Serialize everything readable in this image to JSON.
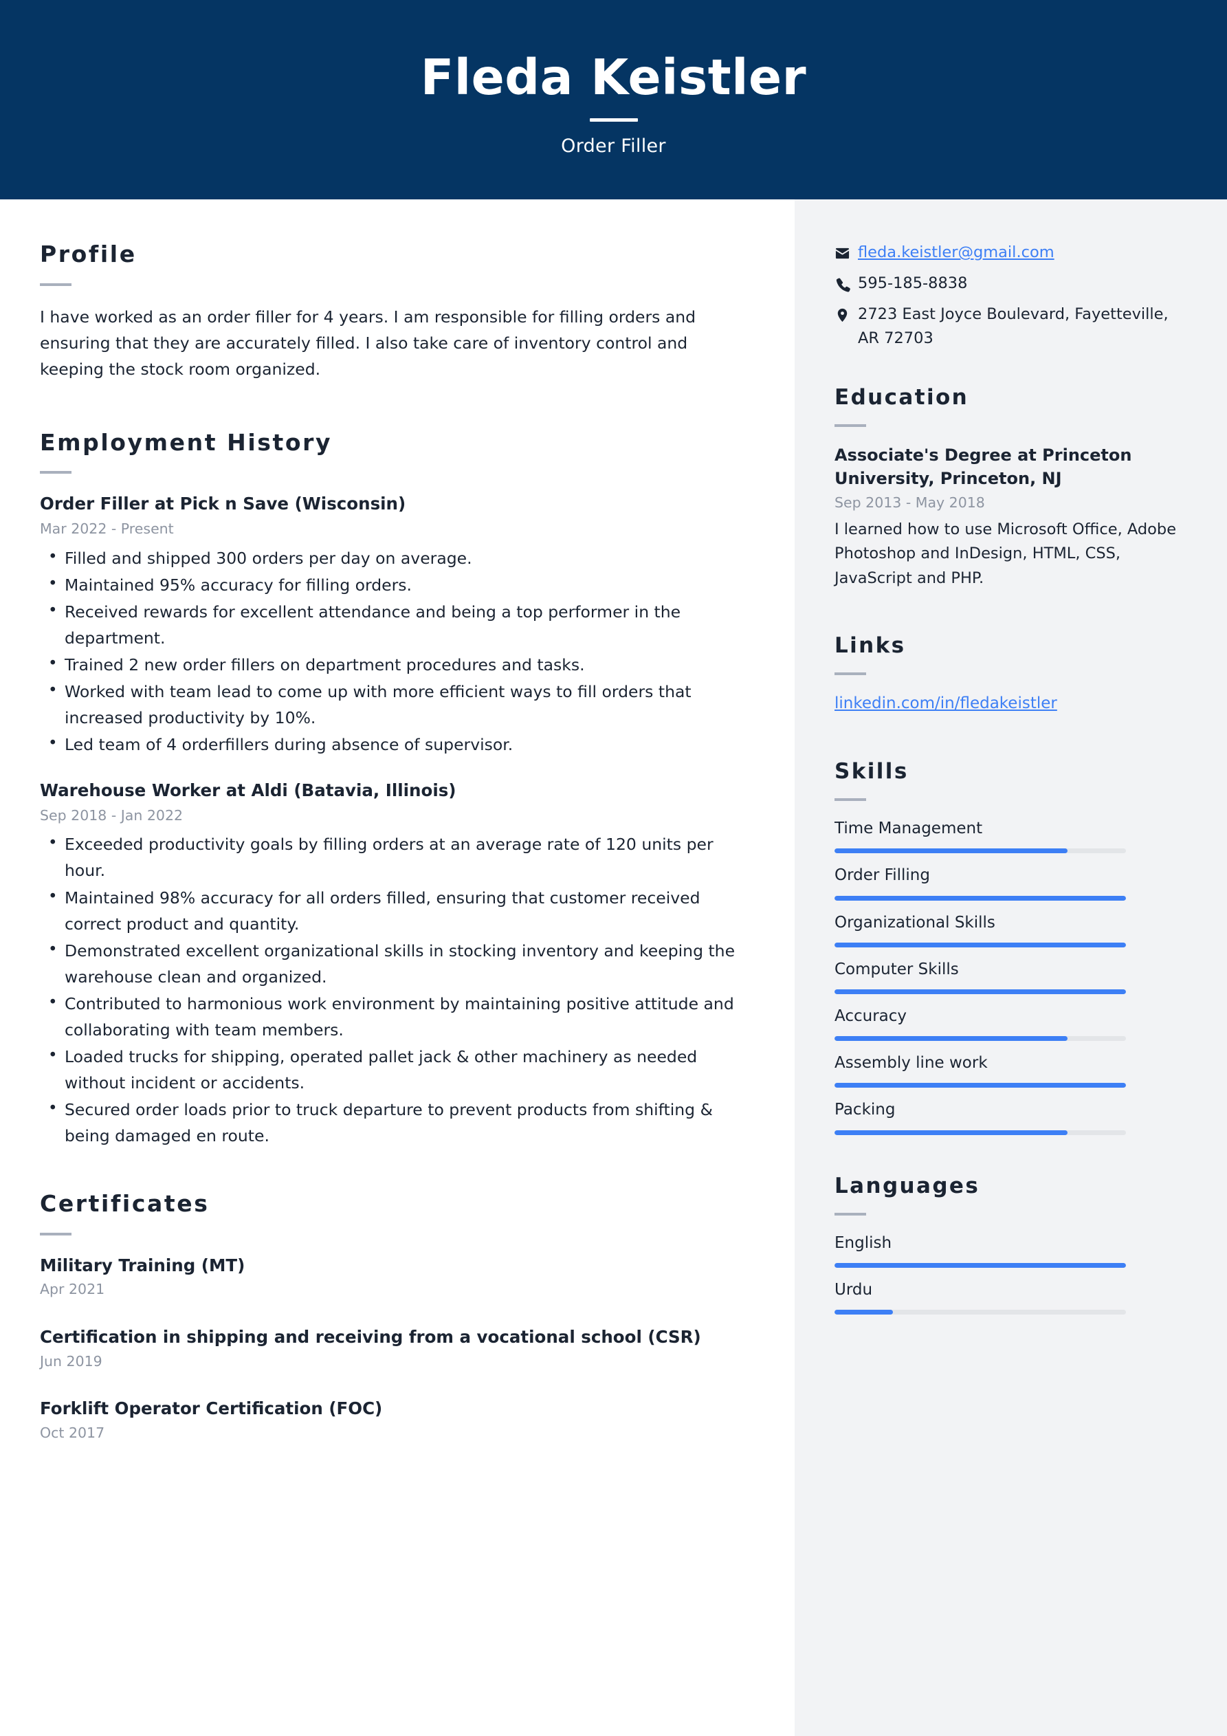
{
  "header": {
    "name": "Fleda Keistler",
    "subtitle": "Order Filler",
    "background_color": "#053563",
    "text_color": "#ffffff"
  },
  "theme": {
    "accent_color": "#3d7ff5",
    "sidebar_background": "#f2f3f5",
    "heading_color": "#1b2432",
    "muted_color": "#8d94a1",
    "rule_color": "#a9b0bd"
  },
  "main": {
    "profile": {
      "heading": "Profile",
      "text": "I have worked as an order filler for 4 years. I am responsible for filling orders and ensuring that they are accurately filled. I also take care of inventory control and keeping the stock room organized."
    },
    "employment": {
      "heading": "Employment History",
      "jobs": [
        {
          "title": "Order Filler at Pick n Save (Wisconsin)",
          "date": "Mar 2022 - Present",
          "bullets": [
            "Filled and shipped 300 orders per day on average.",
            "Maintained 95% accuracy for filling orders.",
            "Received rewards for excellent attendance and being a top performer in the department.",
            "Trained 2 new order fillers on department procedures and tasks.",
            "Worked with team lead to come up with more efficient ways to fill orders that increased productivity by 10%.",
            "Led team of 4 orderfillers during absence of supervisor."
          ]
        },
        {
          "title": "Warehouse Worker at Aldi (Batavia, Illinois)",
          "date": "Sep 2018 - Jan 2022",
          "bullets": [
            "Exceeded productivity goals by filling orders at an average rate of 120 units per hour.",
            "Maintained 98% accuracy for all orders filled, ensuring that customer received correct product and quantity.",
            "Demonstrated excellent organizational skills in stocking inventory and keeping the warehouse clean and organized.",
            "Contributed to harmonious work environment by maintaining positive attitude and collaborating with team members.",
            "Loaded trucks for shipping, operated pallet jack & other machinery as needed without incident or accidents.",
            "Secured order loads prior to truck departure to prevent products from shifting & being damaged en route."
          ]
        }
      ]
    },
    "certificates": {
      "heading": "Certificates",
      "items": [
        {
          "title": "Military Training (MT)",
          "date": "Apr 2021"
        },
        {
          "title": "Certification in shipping and receiving from a vocational school (CSR)",
          "date": "Jun 2019"
        },
        {
          "title": "Forklift Operator Certification (FOC)",
          "date": "Oct 2017"
        }
      ]
    }
  },
  "sidebar": {
    "contact": [
      {
        "icon": "envelope-icon",
        "text": "fleda.keistler@gmail.com",
        "is_link": true
      },
      {
        "icon": "phone-icon",
        "text": "595-185-8838",
        "is_link": false
      },
      {
        "icon": "location-pin-icon",
        "text": "2723 East Joyce Boulevard, Fayetteville, AR 72703",
        "is_link": false
      }
    ],
    "education": {
      "heading": "Education",
      "title": "Associate's Degree at Princeton University, Princeton, NJ",
      "date": "Sep 2013 - May 2018",
      "description": "I learned how to use Microsoft Office, Adobe Photoshop and InDesign, HTML, CSS, JavaScript and PHP."
    },
    "links": {
      "heading": "Links",
      "items": [
        {
          "text": "linkedin.com/in/fledakeistler"
        }
      ]
    },
    "skills": {
      "heading": "Skills",
      "items": [
        {
          "label": "Time Management",
          "level": 80
        },
        {
          "label": "Order Filling",
          "level": 100
        },
        {
          "label": "Organizational Skills",
          "level": 100
        },
        {
          "label": "Computer Skills",
          "level": 100
        },
        {
          "label": "Accuracy",
          "level": 80
        },
        {
          "label": "Assembly line work",
          "level": 100
        },
        {
          "label": "Packing",
          "level": 80
        }
      ]
    },
    "languages": {
      "heading": "Languages",
      "items": [
        {
          "label": "English",
          "level": 100
        },
        {
          "label": "Urdu",
          "level": 20
        }
      ]
    }
  }
}
